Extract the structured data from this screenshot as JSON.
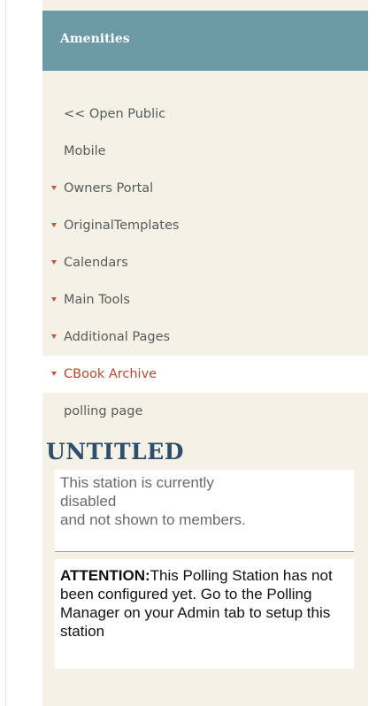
{
  "panel": {
    "header_title": "Amenities"
  },
  "nav": {
    "items": [
      {
        "label": "<< Open Public",
        "caret": false,
        "active": false
      },
      {
        "label": "Mobile",
        "caret": false,
        "active": false
      },
      {
        "label": "Owners Portal",
        "caret": true,
        "active": false
      },
      {
        "label": "OriginalTemplates",
        "caret": true,
        "active": false
      },
      {
        "label": "Calendars",
        "caret": true,
        "active": false
      },
      {
        "label": "Main Tools",
        "caret": true,
        "active": false
      },
      {
        "label": "Additional Pages",
        "caret": true,
        "active": false
      },
      {
        "label": "CBook Archive",
        "caret": true,
        "active": true
      },
      {
        "label": "polling page",
        "caret": false,
        "active": false
      }
    ]
  },
  "station": {
    "title": "UNTITLED",
    "disabled_lines": [
      "This station is currently",
      "disabled",
      "and not shown to members."
    ],
    "attention_label": "ATTENTION:",
    "attention_text": "This Polling Station has not been configured yet. Go to the Polling Manager on your Admin tab to setup this station"
  },
  "colors": {
    "panel_bg": "#f4f2e6",
    "header_bg": "#6b9aa4",
    "title_color": "#2f4e6b",
    "caret_color": "#c0583a",
    "active_text": "#b24a2e"
  },
  "icons": {
    "caret": "caret-down-icon"
  }
}
